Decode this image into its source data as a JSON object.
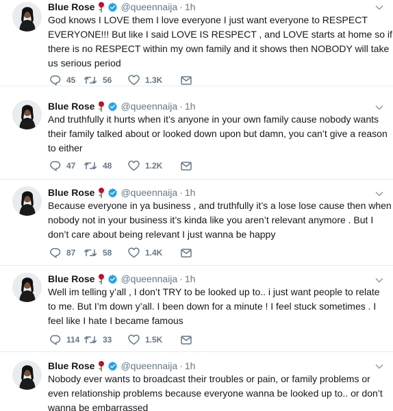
{
  "tweets": [
    {
      "name": "Blue Rose",
      "handle": "@queennaija",
      "dot": "·",
      "time": "1h",
      "lines": [
        "God knows I LOVE them I love everyone I just want everyone to RESPECT",
        "EVERYONE!!! But like I said LOVE IS RESPECT , and LOVE starts at home so if",
        "there is no RESPECT within my own family and it shows then NOBODY will take",
        "us serious period"
      ],
      "replies": "45",
      "retweets": "56",
      "likes": "1.3K"
    },
    {
      "name": "Blue Rose",
      "handle": "@queennaija",
      "dot": "·",
      "time": "1h",
      "lines": [
        "And truthfully it hurts when it’s anyone in your own family cause nobody wants",
        "their family talked about or looked down upon but damn, you can’t give a reason",
        "to either"
      ],
      "replies": "47",
      "retweets": "48",
      "likes": "1.2K"
    },
    {
      "name": "Blue Rose",
      "handle": "@queennaija",
      "dot": "·",
      "time": "1h",
      "lines": [
        "Because everyone in ya business , and truthfully it’s a lose lose cause then when",
        "nobody not in your business it’s kinda like you aren’t relevant anymore . But I",
        "don’t care about being relevant I just wanna be happy"
      ],
      "replies": "87",
      "retweets": "58",
      "likes": "1.4K"
    },
    {
      "name": "Blue Rose",
      "handle": "@queennaija",
      "dot": "·",
      "time": "1h",
      "lines": [
        "Well im telling y’all , I don’t TRY to be looked up to.. i just want people to relate",
        "to me. But I’m down y’all. I been down for a minute ! I feel stuck sometimes . I",
        "feel like I hate I became famous"
      ],
      "replies": "114",
      "retweets": "33",
      "likes": "1.5K"
    },
    {
      "name": "Blue Rose",
      "handle": "@queennaija",
      "dot": "·",
      "time": "1h",
      "lines": [
        "Nobody ever wants to broadcast their troubles or pain, or family problems or",
        "even relationship problems because everyone wanna be looked up to.. or don’t",
        "wanna be embarrassed"
      ],
      "replies": "",
      "retweets": "",
      "likes": ""
    }
  ],
  "colors": {
    "text": "#14171a",
    "muted": "#657786",
    "verified": "#1da1f2",
    "rose": "#c8102e",
    "divider": "#e6ecf0"
  },
  "icons": {
    "avatar": "profile-photo",
    "rose": "rose-emoji",
    "verified": "verified-badge-icon",
    "caret": "chevron-down-icon",
    "reply": "reply-bubble-icon",
    "retweet": "retweet-icon",
    "like": "heart-icon",
    "dm": "envelope-icon"
  }
}
